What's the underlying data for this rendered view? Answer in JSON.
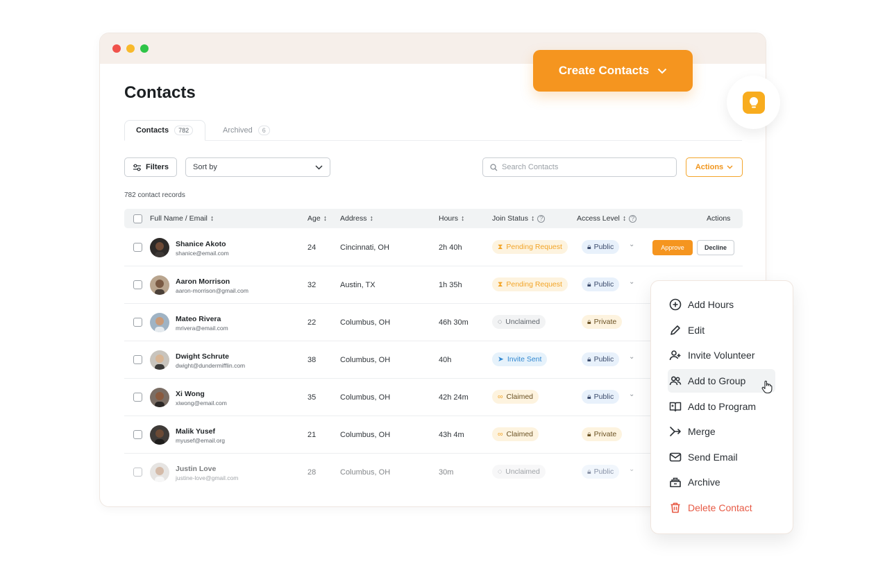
{
  "window": {
    "title": "Contacts",
    "tabs": [
      {
        "label": "Contacts",
        "count": "782"
      },
      {
        "label": "Archived",
        "count": "6"
      }
    ],
    "toolbar": {
      "filters_label": "Filters",
      "sort_placeholder": "Sort by",
      "search_placeholder": "Search Contacts",
      "actions_label": "Actions"
    },
    "record_count": "782 contact records",
    "columns": {
      "name": "Full Name / Email",
      "age": "Age",
      "address": "Address",
      "hours": "Hours",
      "join_status": "Join Status",
      "access_level": "Access Level",
      "actions": "Actions"
    },
    "rows": [
      {
        "name": "Shanice Akoto",
        "email": "shanice@email.com",
        "age": "24",
        "address": "Cincinnati, OH",
        "hours": "2h 40h",
        "status": "Pending Request",
        "access": "Public"
      },
      {
        "name": "Aaron Morrison",
        "email": "aaron-morrison@gmail.com",
        "age": "32",
        "address": "Austin, TX",
        "hours": "1h 35h",
        "status": "Pending Request",
        "access": "Public"
      },
      {
        "name": "Mateo Rivera",
        "email": "mrivera@email.com",
        "age": "22",
        "address": "Columbus, OH",
        "hours": "46h 30m",
        "status": "Unclaimed",
        "access": "Private"
      },
      {
        "name": "Dwight Schrute",
        "email": "dwight@dundermifflin.com",
        "age": "38",
        "address": "Columbus, OH",
        "hours": "40h",
        "status": "Invite Sent",
        "access": "Public"
      },
      {
        "name": "Xi Wong",
        "email": "xiwong@email.com",
        "age": "35",
        "address": "Columbus, OH",
        "hours": "42h 24m",
        "status": "Claimed",
        "access": "Public"
      },
      {
        "name": "Malik Yusef",
        "email": "myusef@email.org",
        "age": "21",
        "address": "Columbus, OH",
        "hours": "43h 4m",
        "status": "Claimed",
        "access": "Private"
      },
      {
        "name": "Justin Love",
        "email": "justine-love@gmail.com",
        "age": "28",
        "address": "Columbus, OH",
        "hours": "30m",
        "status": "Unclaimed",
        "access": "Public"
      }
    ],
    "row_actions": {
      "approve": "Approve",
      "decline": "Decline"
    }
  },
  "create_button": "Create Contacts",
  "menu": {
    "items": [
      {
        "label": "Add Hours",
        "icon": "plus-circle-icon"
      },
      {
        "label": "Edit",
        "icon": "pencil-icon"
      },
      {
        "label": "Invite Volunteer",
        "icon": "user-plus-icon"
      },
      {
        "label": "Add to Group",
        "icon": "users-icon"
      },
      {
        "label": "Add to Program",
        "icon": "book-plus-icon"
      },
      {
        "label": "Merge",
        "icon": "merge-icon"
      },
      {
        "label": "Send Email",
        "icon": "mail-icon"
      },
      {
        "label": "Archive",
        "icon": "archive-icon"
      },
      {
        "label": "Delete Contact",
        "icon": "trash-icon"
      }
    ]
  },
  "colors": {
    "accent": "#f5951f",
    "danger": "#e75a45",
    "invite": "#3288d1"
  }
}
